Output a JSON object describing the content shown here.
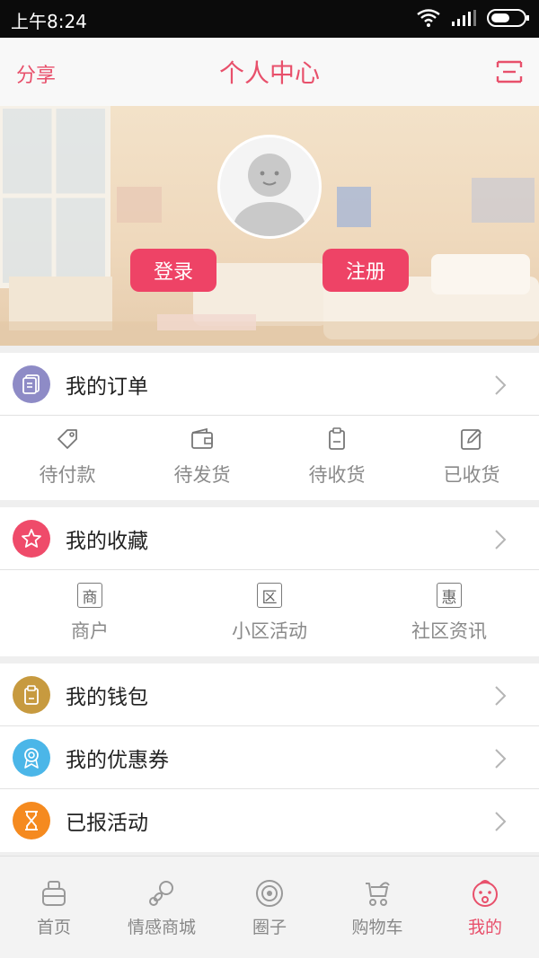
{
  "status_bar": {
    "time": "上午8:24"
  },
  "header": {
    "share_label": "分享",
    "title": "个人中心",
    "menu_icon": "menu-icon"
  },
  "profile": {
    "login_label": "登录",
    "register_label": "注册"
  },
  "orders": {
    "label": "我的订单",
    "items": [
      {
        "label": "待付款",
        "icon": "tag-icon"
      },
      {
        "label": "待发货",
        "icon": "wallet-icon"
      },
      {
        "label": "待收货",
        "icon": "clipboard-icon"
      },
      {
        "label": "已收货",
        "icon": "edit-icon"
      }
    ]
  },
  "favorites": {
    "label": "我的收藏",
    "items": [
      {
        "label": "商户",
        "glyph": "商"
      },
      {
        "label": "小区活动",
        "glyph": "区"
      },
      {
        "label": "社区资讯",
        "glyph": "惠"
      }
    ]
  },
  "menu_rows": [
    {
      "label": "我的钱包",
      "icon": "wallet-icon",
      "color": "#c79a3f"
    },
    {
      "label": "我的优惠券",
      "icon": "coupon-icon",
      "color": "#4bb6e8"
    },
    {
      "label": "已报活动",
      "icon": "hourglass-icon",
      "color": "#f58a1f"
    }
  ],
  "tabs": [
    {
      "label": "首页",
      "icon": "home-icon"
    },
    {
      "label": "情感商城",
      "icon": "pacifier-icon"
    },
    {
      "label": "圈子",
      "icon": "circle-icon"
    },
    {
      "label": "购物车",
      "icon": "stroller-icon"
    },
    {
      "label": "我的",
      "icon": "baby-face-icon",
      "active": true
    }
  ],
  "colors": {
    "accent": "#e8506b",
    "button": "#ee4366",
    "orders_icon_bg": "#8e8bc6",
    "favorites_icon_bg": "#ef4b6a"
  }
}
